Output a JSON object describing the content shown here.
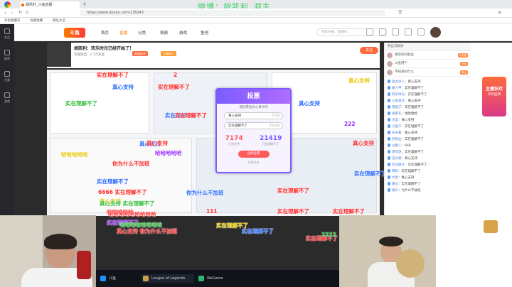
{
  "watermark": "微博：胡凯利_洞主",
  "browser": {
    "tab_title": "胡凯利_斗鱼直播",
    "url": "https://www.douyu.com/138243",
    "bookmarks": [
      "手机收藏夹",
      "谷歌收藏",
      "网址大全"
    ]
  },
  "site": {
    "logo": "斗鱼",
    "nav": [
      "首页",
      "直播",
      "分类",
      "视频",
      "游戏",
      "鱼吧"
    ],
    "search_placeholder": "搜索主播、直播间",
    "header_icons": [
      "history-icon",
      "follow-icon",
      "message-icon",
      "download-icon",
      "gift-icon"
    ],
    "left_rail": [
      "关注",
      "推荐",
      "分类",
      "游戏"
    ]
  },
  "streamer": {
    "title": "胡凯利：欢乐时光已经开始了！",
    "meta": "英雄联盟 · 2.7万热度",
    "tags": [
      "超管推荐",
      "主播热门"
    ],
    "follow": "关注"
  },
  "vote": {
    "title": "投票",
    "subtitle": "请投票给你心目中的",
    "options": [
      {
        "label": "真心支持",
        "count": "7174"
      },
      {
        "label": "实在理解不了",
        "count": "21419"
      }
    ],
    "left_total": "7174",
    "right_total": "21419",
    "left_caption": "已投支持",
    "right_caption": "已投理解不了",
    "submit": "立即投票",
    "footer": "投票结束"
  },
  "danmu": [
    "实在理解不了",
    "真心支持",
    "2",
    "哈哈哈哈哈",
    "真心支持",
    "实在理解不了",
    "实在理解不了",
    "真心支持",
    "哈哈哈哈哈",
    "你为什么不加班",
    "实在理解不了",
    "哈哈哈哈哈",
    "真心支持",
    "实在理解不了",
    "6666 实在理解不了",
    "真心支持 实在理解不了",
    "哈哈哈哈哈哈哈哈哈",
    "实在理解不了",
    "真心支持 你为什么不加班",
    "你为什么不加班",
    "111",
    "实在理解不了",
    "真心支持",
    "实在理解不了",
    "哈哈哈哈哈哈哈哈",
    "实在理解不了",
    "222",
    "真心支持",
    "实在理解不了",
    "实在理解不了",
    "真心支持",
    "实在理解不了",
    "实在理解不了",
    "2222",
    "实在理解不了"
  ],
  "chat": {
    "header": "粉丝贡献榜",
    "ranks": [
      {
        "name": "胡凯利的粉丝",
        "badge": "大贵族"
      },
      {
        "name": "斗鱼用户",
        "badge": "贵族"
      },
      {
        "name": "不知道叫什么",
        "badge": "骑士"
      }
    ],
    "messages": [
      {
        "user": "鱼丸达人",
        "text": "真心支持"
      },
      {
        "user": "路人甲",
        "text": "实在理解不了"
      },
      {
        "user": "欢乐时光",
        "text": "实在理解不了"
      },
      {
        "user": "斗鱼观众",
        "text": "真心支持"
      },
      {
        "user": "夜猫子",
        "text": "实在理解不了"
      },
      {
        "user": "胡家军",
        "text": "哈哈哈哈"
      },
      {
        "user": "水友",
        "text": "真心支持"
      },
      {
        "user": "小鱼干",
        "text": "实在理解不了"
      },
      {
        "user": "天天看",
        "text": "真心支持"
      },
      {
        "user": "老粉丝",
        "text": "实在理解不了"
      },
      {
        "user": "过路人",
        "text": "666"
      },
      {
        "user": "游戏迷",
        "text": "实在理解不了"
      },
      {
        "user": "追光者",
        "text": "真心支持"
      },
      {
        "user": "吃瓜群众",
        "text": "实在理解不了"
      },
      {
        "user": "萌新",
        "text": "实在理解不了"
      },
      {
        "user": "大佬",
        "text": "真心支持"
      },
      {
        "user": "路过",
        "text": "实在理解不了"
      },
      {
        "user": "观众",
        "text": "为什么不加班"
      }
    ]
  },
  "right_rail": {
    "promo": "主播狂欢",
    "promo2": "年终盛典"
  },
  "bottom_bar": [
    "斗鱼",
    "League of Legends",
    "WeGame"
  ]
}
